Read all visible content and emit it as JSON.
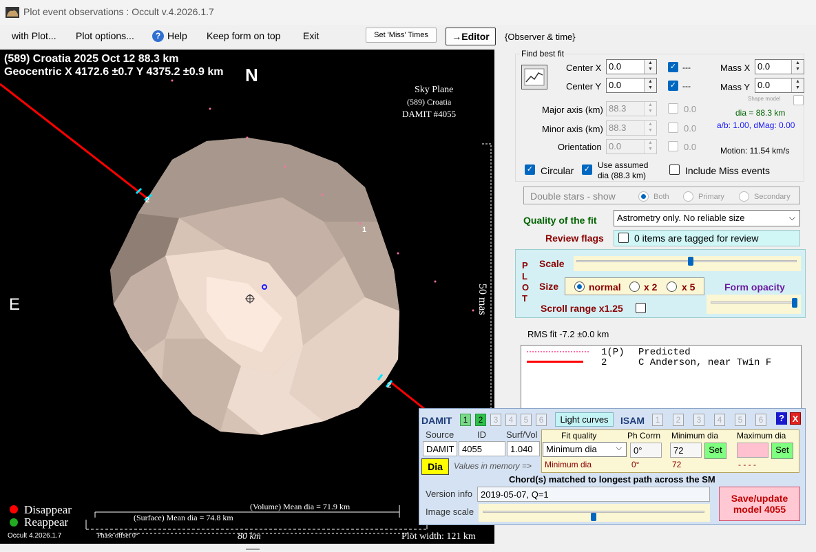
{
  "window": {
    "title": "Plot event observations : Occult v.4.2026.1.7"
  },
  "menu": {
    "items": [
      "with Plot...",
      "Plot options...",
      "Help",
      "Keep form on top",
      "Exit"
    ],
    "set_miss_times": "Set 'Miss' Times",
    "editor": "→Editor",
    "observer_time": "{Observer & time}"
  },
  "plot": {
    "header_line1": "(589) Croatia  2025 Oct 12   88.3 km",
    "header_line2": "Geocentric  X  4172.6 ±0.7  Y 4375.2 ±0.9 km",
    "north": "N",
    "east": "E",
    "sky_plane": "Sky Plane",
    "sky_plane_object": "(589) Croatia",
    "sky_plane_model": "DAMIT #4055",
    "scale_label": "50 mas",
    "chord_labels": [
      "2",
      "2",
      "1"
    ],
    "legend_disappear": "Disappear",
    "legend_reappear": "Reappear",
    "volume_dia": "(Volume) Mean dia = 71.9 km",
    "surface_dia": "(Surface) Mean dia = 74.8 km",
    "version": "Occult 4.2026.1.7",
    "phase_offset": "Phase offset 0°",
    "scale_km": "80 km",
    "plot_width": "Plot width: 121 km"
  },
  "fit": {
    "group_title": "Find best fit",
    "center_x_label": "Center X",
    "center_x": "0.0",
    "center_y_label": "Center Y",
    "center_y": "0.0",
    "dash": "---",
    "mass_x_label": "Mass X",
    "mass_x": "0.0",
    "mass_y_label": "Mass Y",
    "mass_y": "0.0",
    "shape_model": "Shape model",
    "major_label": "Major axis (km)",
    "major": "88.3",
    "minor_label": "Minor axis (km)",
    "minor": "88.3",
    "orient_label": "Orientation",
    "orient": "0.0",
    "zero": "0.0",
    "dia_text": "dia = 88.3 km",
    "ab_text": "a/b: 1.00, dMag: 0.00",
    "motion": "Motion: 11.54 km/s",
    "circular": "Circular",
    "use_assumed": "Use assumed",
    "use_assumed2": "dia (88.3 km)",
    "include_miss": "Include Miss events"
  },
  "double_stars": {
    "label": "Double stars - show",
    "both": "Both",
    "primary": "Primary",
    "secondary": "Secondary"
  },
  "quality": {
    "label": "Quality of the fit",
    "value": "Astrometry only. No reliable size"
  },
  "review": {
    "label": "Review flags",
    "value": "0 items are tagged for review"
  },
  "plotpanel": {
    "plot_letters": [
      "P",
      "L",
      "O",
      "T"
    ],
    "scale": "Scale",
    "size": "Size",
    "normal": "normal",
    "x2": "x 2",
    "x5": "x 5",
    "form_opacity": "Form opacity",
    "scroll_range": "Scroll range x1.25",
    "scale_slider": 0.5,
    "opacity_slider": 1.0
  },
  "rms": "RMS fit -7.2 ±0.0 km",
  "observers": [
    {
      "num": "1(P)",
      "name": "Predicted",
      "style": "dots"
    },
    {
      "num": "2",
      "name": "C Anderson, near Twin F",
      "style": "line"
    }
  ],
  "damit": {
    "title": "DAMIT",
    "nums": [
      "1",
      "2",
      "3",
      "4",
      "5",
      "6"
    ],
    "light_curves": "Light curves",
    "isam": "ISAM",
    "isam_nums": [
      "1",
      "2",
      "3",
      "4",
      "5",
      "6"
    ],
    "help": "?",
    "close": "X",
    "source_label": "Source",
    "id_label": "ID",
    "surfvol_label": "Surf/Vol",
    "source": "DAMIT",
    "id": "4055",
    "surfvol": "1.040",
    "dia_button": "Dia",
    "values_memory": "Values in memory =>",
    "fit_quality_label": "Fit quality",
    "fit_quality": "Minimum dia",
    "fit_quality_mem": "Minimum dia",
    "ph_corr_label": "Ph Corrn",
    "ph_corr": "0°",
    "ph_corr_mem": "0°",
    "min_dia_label": "Minimum dia",
    "min_dia": "72",
    "min_dia_mem": "72",
    "max_dia_label": "Maximum dia",
    "max_dia": "",
    "max_dia_mem": "- - - -",
    "set": "Set",
    "chords_matched": "Chord(s) matched to longest path across the SM",
    "version_label": "Version info",
    "version": "2019-05-07, Q=1",
    "image_scale_label": "Image scale",
    "image_scale_slider": 0.5,
    "save_update": "Save/update",
    "save_update2": "model 4055"
  },
  "colors": {
    "chord_red": "#ff0000",
    "cyan": "#00e5ff",
    "asteroid": "#d9c6ba",
    "accent_blue": "#0067c0"
  }
}
